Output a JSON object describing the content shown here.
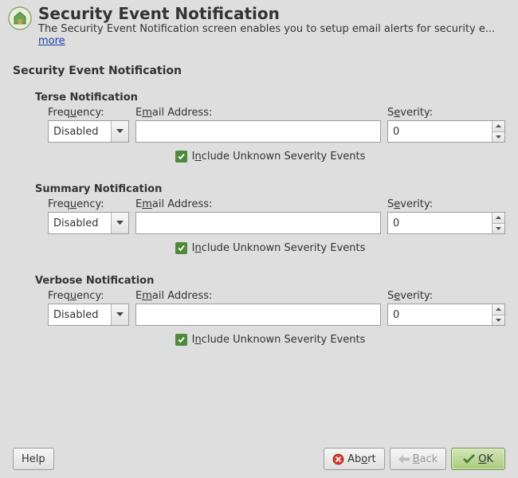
{
  "header": {
    "title": "Security Event Notification",
    "description": "The Security Event Notification screen enables you to setup email alerts for security e...",
    "more": "more"
  },
  "section_title": "Security Event Notification",
  "labels": {
    "frequency": "Frequency:",
    "frequency_u": "u",
    "email": "Email Address:",
    "email_u": "m",
    "severity": "Severity:",
    "severity_u": "e",
    "include": "Include Unknown Severity Events",
    "include_u": "n"
  },
  "groups": {
    "terse": {
      "title": "Terse Notification",
      "frequency": "Disabled",
      "email": "",
      "severity": "0",
      "include": true
    },
    "summary": {
      "title": "Summary Notification",
      "frequency": "Disabled",
      "email": "",
      "severity": "0",
      "include": true
    },
    "verbose": {
      "title": "Verbose Notification",
      "frequency": "Disabled",
      "email": "",
      "severity": "0",
      "include": true
    }
  },
  "footer": {
    "help": "Help",
    "abort": "Abort",
    "abort_u": "o",
    "back": "Back",
    "back_u": "B",
    "ok": "OK",
    "ok_u": "O"
  }
}
